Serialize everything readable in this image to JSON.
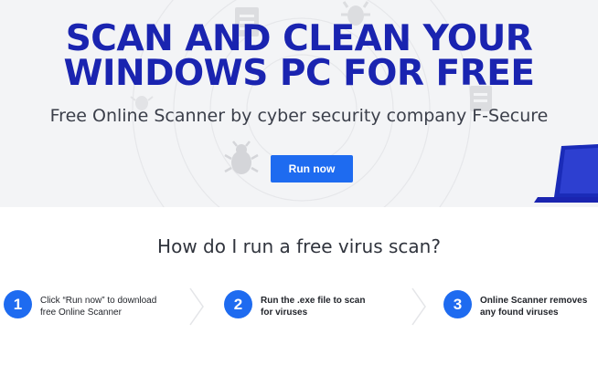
{
  "hero": {
    "headline_line1": "SCAN AND CLEAN YOUR",
    "headline_line2": "WINDOWS PC FOR FREE",
    "subtitle": "Free Online Scanner by cyber security company F-Secure",
    "run_button_label": "Run now"
  },
  "how_to": {
    "title": "How do I run a free virus scan?",
    "steps": [
      {
        "number": "1",
        "text": "Click “Run now” to download free Online Scanner"
      },
      {
        "number": "2",
        "text": "Run the .exe file to scan for viruses"
      },
      {
        "number": "3",
        "text": "Online Scanner removes any found viruses"
      }
    ]
  },
  "colors": {
    "headline": "#1a24b0",
    "accent": "#1e6bf0",
    "hero_background": "#f3f4f6"
  },
  "icons": [
    "bug-icon",
    "document-icon",
    "laptop-icon",
    "chevron-right-icon"
  ]
}
